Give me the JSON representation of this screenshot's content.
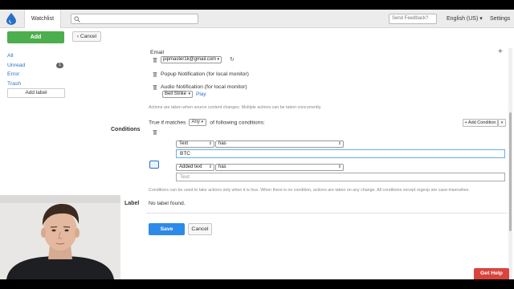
{
  "topbar": {
    "tab": "Watchlist",
    "search_placeholder": "",
    "feedback_placeholder": "Send Feedback?",
    "language": "English (US) ▾",
    "settings": "Settings"
  },
  "toolbar": {
    "add_label": "Add",
    "cancel_label": "Cancel"
  },
  "sidebar": {
    "items": [
      {
        "label": "All"
      },
      {
        "label": "Unread",
        "badge": "1"
      },
      {
        "label": "Error"
      },
      {
        "label": "Trash"
      }
    ],
    "add_label_button": "Add label"
  },
  "actions": {
    "email_label": "Email",
    "email_value": "pipmaster1k@gmail.com",
    "popup_label": "Popup Notification (for local monitor)",
    "audio_label": "Audio Notification (for local monitor)",
    "sound_value": "Bell Strike",
    "play_label": "Play",
    "help": "Actions are taken when source content changes. Multiple actions can be taken concurrently."
  },
  "conditions": {
    "title": "Conditions",
    "sentence_prefix": "True if matches",
    "match_value": "Any",
    "sentence_suffix": "of following conditions:",
    "add_button": "+ Add Condition",
    "rows": [
      {
        "field": "Text",
        "operator": "has",
        "value": "BTC",
        "placeholder": ""
      },
      {
        "field": "Added text",
        "operator": "has",
        "value": "",
        "placeholder": "Text"
      }
    ],
    "help": "Conditions can be used to take actions only when it is true. When there is no condition, actions are taken on any change. All conditions except regexp are case-insensitive."
  },
  "label_section": {
    "title": "Label",
    "value": "No label found."
  },
  "footer": {
    "save_label": "Save",
    "cancel_label": "Cancel"
  },
  "help_button": "Get Help",
  "colors": {
    "add_green": "#4cae4c",
    "save_blue": "#2d8ae8",
    "link_blue": "#2a6fc9",
    "help_red": "#d9453d"
  }
}
